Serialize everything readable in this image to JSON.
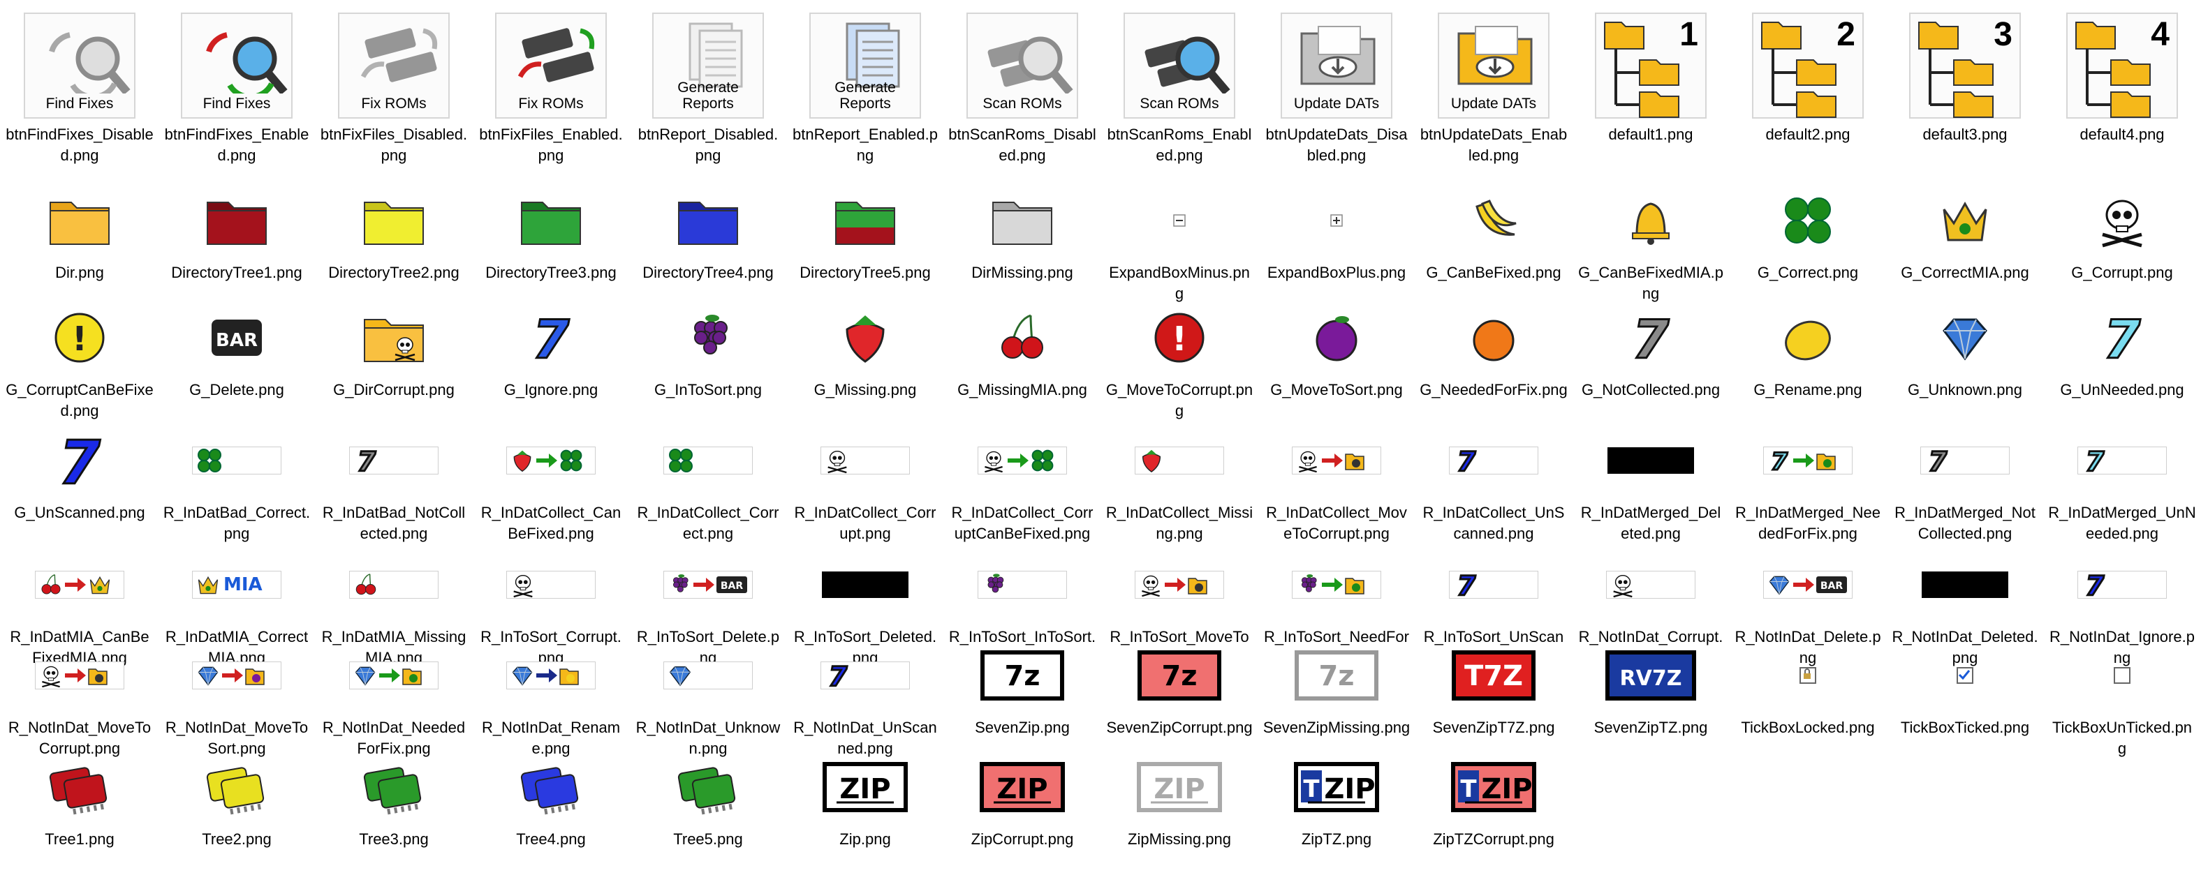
{
  "items": [
    {
      "label": "btnFindFixes_Disabled.png",
      "caption": "Find Fixes",
      "icon": "find-fixes-disabled-icon"
    },
    {
      "label": "btnFindFixes_Enabled.png",
      "caption": "Find Fixes",
      "icon": "find-fixes-enabled-icon"
    },
    {
      "label": "btnFixFiles_Disabled.png",
      "caption": "Fix ROMs",
      "icon": "fix-roms-disabled-icon"
    },
    {
      "label": "btnFixFiles_Enabled.png",
      "caption": "Fix ROMs",
      "icon": "fix-roms-enabled-icon"
    },
    {
      "label": "btnReport_Disabled.png",
      "caption": "Generate Reports",
      "icon": "report-disabled-icon"
    },
    {
      "label": "btnReport_Enabled.png",
      "caption": "Generate Reports",
      "icon": "report-enabled-icon"
    },
    {
      "label": "btnScanRoms_Disabled.png",
      "caption": "Scan ROMs",
      "icon": "scan-roms-disabled-icon"
    },
    {
      "label": "btnScanRoms_Enabled.png",
      "caption": "Scan ROMs",
      "icon": "scan-roms-enabled-icon"
    },
    {
      "label": "btnUpdateDats_Disabled.png",
      "caption": "Update DATs",
      "icon": "update-dats-disabled-icon"
    },
    {
      "label": "btnUpdateDats_Enabled.png",
      "caption": "Update DATs",
      "icon": "update-dats-enabled-icon"
    },
    {
      "label": "default1.png",
      "num": "1",
      "icon": "folder-tree-icon"
    },
    {
      "label": "default2.png",
      "num": "2",
      "icon": "folder-tree-icon"
    },
    {
      "label": "default3.png",
      "num": "3",
      "icon": "folder-tree-icon"
    },
    {
      "label": "default4.png",
      "num": "4",
      "icon": "folder-tree-icon"
    },
    {
      "label": "Dir.png",
      "icon": "folder-icon"
    },
    {
      "label": "DirectoryTree1.png",
      "icon": "folder-red-icon"
    },
    {
      "label": "DirectoryTree2.png",
      "icon": "folder-yellow-icon"
    },
    {
      "label": "DirectoryTree3.png",
      "icon": "folder-green-icon"
    },
    {
      "label": "DirectoryTree4.png",
      "icon": "folder-blue-icon"
    },
    {
      "label": "DirectoryTree5.png",
      "icon": "folder-green-red-icon"
    },
    {
      "label": "DirMissing.png",
      "icon": "folder-grey-icon"
    },
    {
      "label": "ExpandBoxMinus.png",
      "icon": "expand-minus-icon"
    },
    {
      "label": "ExpandBoxPlus.png",
      "icon": "expand-plus-icon"
    },
    {
      "label": "G_CanBeFixed.png",
      "icon": "banana-icon"
    },
    {
      "label": "G_CanBeFixedMIA.png",
      "icon": "bell-icon"
    },
    {
      "label": "G_Correct.png",
      "icon": "clover-icon"
    },
    {
      "label": "G_CorrectMIA.png",
      "icon": "crown-clover-icon"
    },
    {
      "label": "G_Corrupt.png",
      "icon": "skull-icon"
    },
    {
      "label": "G_CorruptCanBeFixed.png",
      "icon": "warning-yellow-icon"
    },
    {
      "label": "G_Delete.png",
      "icon": "bar-icon",
      "text": "BAR"
    },
    {
      "label": "G_DirCorrupt.png",
      "icon": "folder-skull-icon"
    },
    {
      "label": "G_Ignore.png",
      "icon": "seven-blue-icon"
    },
    {
      "label": "G_InToSort.png",
      "icon": "grapes-icon"
    },
    {
      "label": "G_Missing.png",
      "icon": "strawberry-icon"
    },
    {
      "label": "G_MissingMIA.png",
      "icon": "cherries-icon"
    },
    {
      "label": "G_MoveToCorrupt.png",
      "icon": "warning-red-icon"
    },
    {
      "label": "G_MoveToSort.png",
      "icon": "plum-icon"
    },
    {
      "label": "G_NeededForFix.png",
      "icon": "orange-icon"
    },
    {
      "label": "G_NotCollected.png",
      "icon": "seven-grey-icon"
    },
    {
      "label": "G_Rename.png",
      "icon": "lemon-icon"
    },
    {
      "label": "G_Unknown.png",
      "icon": "diamond-icon"
    },
    {
      "label": "G_UnNeeded.png",
      "icon": "seven-cyan-icon"
    },
    {
      "label": "G_UnScanned.png",
      "icon": "seven-blue-large-icon"
    },
    {
      "label": "R_InDatBad_Correct.png",
      "icon": "clover-bar-icon"
    },
    {
      "label": "R_InDatBad_NotCollected.png",
      "icon": "seven-grey-bar-icon"
    },
    {
      "label": "R_InDatCollect_CanBeFixed.png",
      "icon": "strawberry-to-clover-icon"
    },
    {
      "label": "R_InDatCollect_Correct.png",
      "icon": "clover-bar-icon"
    },
    {
      "label": "R_InDatCollect_Corrupt.png",
      "icon": "skull-bar-icon"
    },
    {
      "label": "R_InDatCollect_CorruptCanBeFixed.png",
      "icon": "skull-to-clover-icon"
    },
    {
      "label": "R_InDatCollect_Missing.png",
      "icon": "strawberry-bar-icon"
    },
    {
      "label": "R_InDatCollect_MoveToCorrupt.png",
      "icon": "skull-to-folder-icon"
    },
    {
      "label": "R_InDatCollect_UnScanned.png",
      "icon": "seven-blue-bar-icon"
    },
    {
      "label": "R_InDatMerged_Deleted.png",
      "icon": "black-bar-icon"
    },
    {
      "label": "R_InDatMerged_NeededForFix.png",
      "icon": "seven-to-folder-icon"
    },
    {
      "label": "R_InDatMerged_NotCollected.png",
      "icon": "seven-grey-bar-icon"
    },
    {
      "label": "R_InDatMerged_UnNeeded.png",
      "icon": "seven-cyan-bar-icon"
    },
    {
      "label": "R_InDatMIA_CanBeFixedMIA.png",
      "icon": "cherries-to-crown-icon"
    },
    {
      "label": "R_InDatMIA_CorrectMIA.png",
      "icon": "crown-mia-icon",
      "text": "MIA"
    },
    {
      "label": "R_InDatMIA_MissingMIA.png",
      "icon": "cherries-bar-icon"
    },
    {
      "label": "R_InToSort_Corrupt.png",
      "icon": "skull-bar-icon"
    },
    {
      "label": "R_InToSort_Delete.png",
      "icon": "grapes-to-bar-icon",
      "text": "BAR"
    },
    {
      "label": "R_InToSort_Deleted.png",
      "icon": "black-bar-icon"
    },
    {
      "label": "R_InToSort_InToSort.png",
      "icon": "grapes-bar-icon"
    },
    {
      "label": "R_InToSort_MoveToCorrupt.png",
      "icon": "skull-to-folder-icon"
    },
    {
      "label": "R_InToSort_NeedForFix.png",
      "icon": "grapes-to-folder-icon"
    },
    {
      "label": "R_InToSort_UnScanned.png",
      "icon": "seven-blue-bar-icon"
    },
    {
      "label": "R_NotInDat_Corrupt.png",
      "icon": "skull-bar-icon"
    },
    {
      "label": "R_NotInDat_Delete.png",
      "icon": "diamond-to-bar-icon",
      "text": "BAR"
    },
    {
      "label": "R_NotInDat_Deleted.png",
      "icon": "black-bar-icon"
    },
    {
      "label": "R_NotInDat_Ignore.png",
      "icon": "seven-blue-bar-icon"
    },
    {
      "label": "R_NotInDat_MoveToCorrupt.png",
      "icon": "skull-to-folder-icon"
    },
    {
      "label": "R_NotInDat_MoveToSort.png",
      "icon": "diamond-to-plum-icon"
    },
    {
      "label": "R_NotInDat_NeededForFix.png",
      "icon": "diamond-to-folder-icon"
    },
    {
      "label": "R_NotInDat_Rename.png",
      "icon": "diamond-to-rename-icon"
    },
    {
      "label": "R_NotInDat_Unknown.png",
      "icon": "diamond-bar-icon"
    },
    {
      "label": "R_NotInDat_UnScanned.png",
      "icon": "seven-blue-bar-icon"
    },
    {
      "label": "SevenZip.png",
      "icon": "sevenzip-icon",
      "text": "7z"
    },
    {
      "label": "SevenZipCorrupt.png",
      "icon": "sevenzip-corrupt-icon",
      "text": "7z"
    },
    {
      "label": "SevenZipMissing.png",
      "icon": "sevenzip-missing-icon",
      "text": "7z"
    },
    {
      "label": "SevenZipT7Z.png",
      "icon": "sevenzip-t7z-icon",
      "text": "T7Z"
    },
    {
      "label": "SevenZipTZ.png",
      "icon": "sevenzip-tz-icon",
      "text": "RV7Z"
    },
    {
      "label": "TickBoxLocked.png",
      "icon": "tickbox-locked-icon"
    },
    {
      "label": "TickBoxTicked.png",
      "icon": "tickbox-ticked-icon"
    },
    {
      "label": "TickBoxUnTicked.png",
      "icon": "tickbox-unticked-icon"
    },
    {
      "label": "Tree1.png",
      "icon": "tree-red-icon"
    },
    {
      "label": "Tree2.png",
      "icon": "tree-yellow-icon"
    },
    {
      "label": "Tree3.png",
      "icon": "tree-green-icon"
    },
    {
      "label": "Tree4.png",
      "icon": "tree-blue-icon"
    },
    {
      "label": "Tree5.png",
      "icon": "tree-green-red-icon"
    },
    {
      "label": "Zip.png",
      "icon": "zip-icon",
      "text": "ZIP"
    },
    {
      "label": "ZipCorrupt.png",
      "icon": "zip-corrupt-icon",
      "text": "ZIP"
    },
    {
      "label": "ZipMissing.png",
      "icon": "zip-missing-icon",
      "text": "ZIP"
    },
    {
      "label": "ZipTZ.png",
      "icon": "zip-tz-icon",
      "text": "ZIP"
    },
    {
      "label": "ZipTZCorrupt.png",
      "icon": "zip-tz-corrupt-icon",
      "text": "ZIP"
    }
  ]
}
